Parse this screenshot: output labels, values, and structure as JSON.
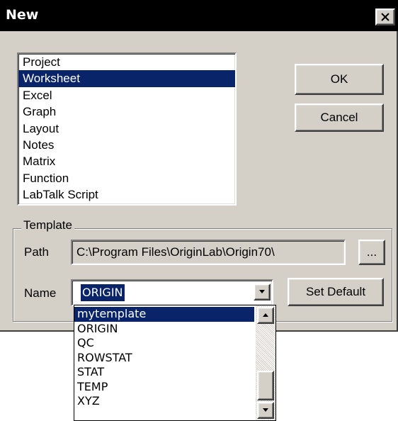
{
  "window": {
    "title": "New"
  },
  "doc_types": {
    "items": [
      "Project",
      "Worksheet",
      "Excel",
      "Graph",
      "Layout",
      "Notes",
      "Matrix",
      "Function",
      "LabTalk Script"
    ],
    "selected": "Worksheet"
  },
  "buttons": {
    "ok": "OK",
    "cancel": "Cancel",
    "browse": "...",
    "set_default": "Set Default"
  },
  "template": {
    "group_label": "Template",
    "path_label": "Path",
    "path_value": "C:\\Program Files\\OriginLab\\Origin70\\",
    "name_label": "Name",
    "name_value": "ORIGIN",
    "options": [
      "mytemplate",
      "ORIGIN",
      "QC",
      "ROWSTAT",
      "STAT",
      "TEMP",
      "XYZ"
    ],
    "highlighted_option": "mytemplate"
  },
  "icons": {
    "close": "close-icon",
    "dropdown": "chevron-down-icon",
    "up": "chevron-up-icon"
  }
}
